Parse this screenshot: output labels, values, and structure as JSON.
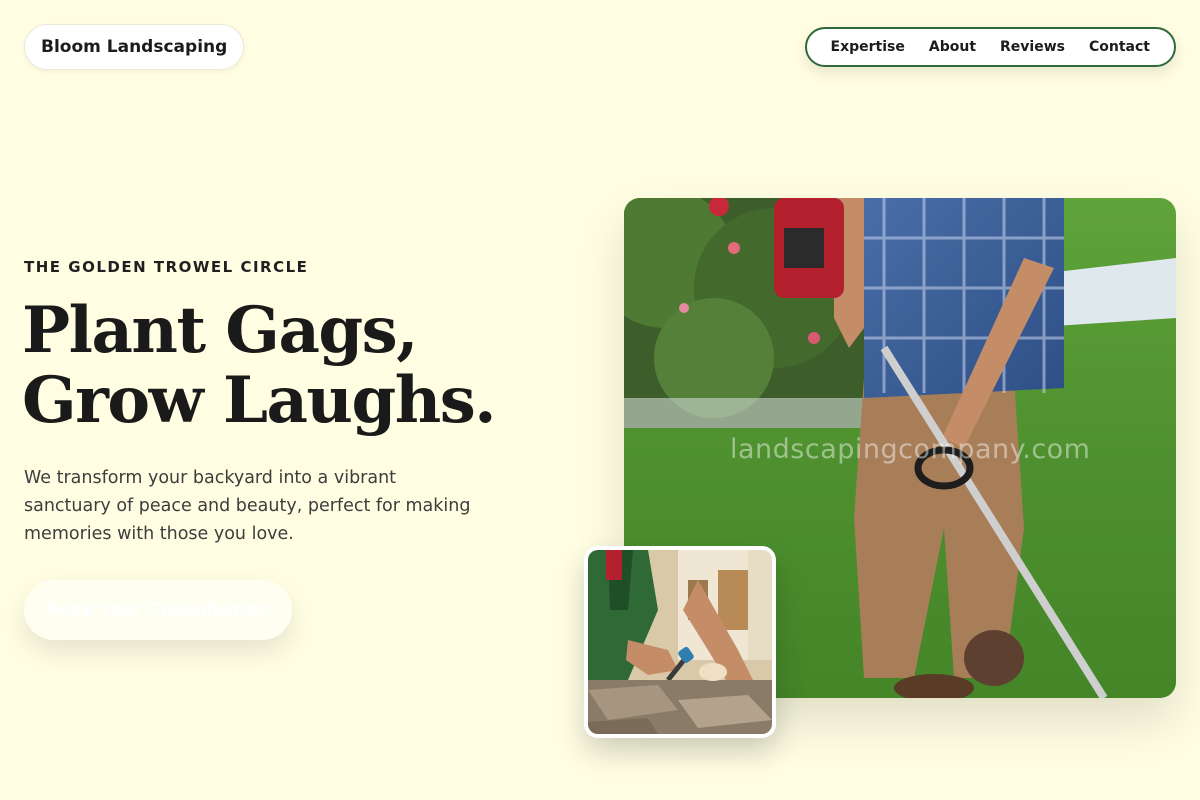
{
  "header": {
    "brand": "Bloom Landscaping",
    "nav": [
      "Expertise",
      "About",
      "Reviews",
      "Contact"
    ],
    "nav_border_color": "#2f6b3a"
  },
  "hero": {
    "eyebrow": "THE GOLDEN TROWEL CIRCLE",
    "headline_line1": "Plant Gags,",
    "headline_line2": "Grow Laughs.",
    "description": "We transform your backyard into a vibrant sanctuary of peace and beauty, perfect for making memories with those you love.",
    "cta_label": "Book Your Consultation"
  },
  "media": {
    "main_watermark": "landscapingcompany.com",
    "main_alt": "landscaper trimming lawn edges with a string trimmer",
    "small_alt": "worker laying stone pavers with a trowel"
  },
  "colors": {
    "background": "#fffee3",
    "accent_green": "#2f6b3a",
    "text_dark": "#1a1a1a"
  }
}
